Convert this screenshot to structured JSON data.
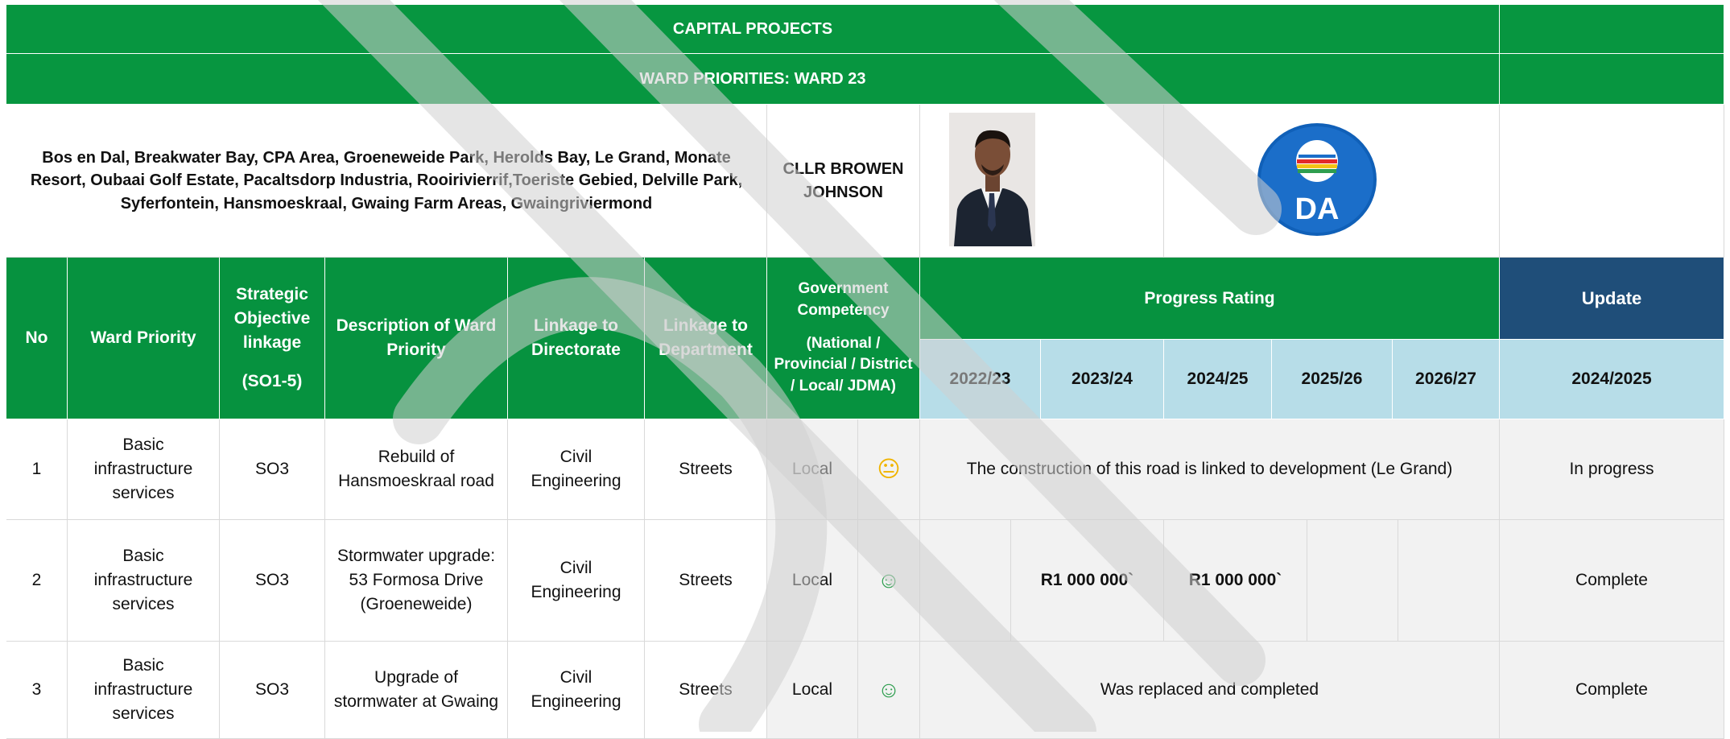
{
  "header": {
    "title": "CAPITAL PROJECTS",
    "subtitle": "WARD PRIORITIES: WARD 23"
  },
  "ward": {
    "areas": "Bos en Dal, Breakwater Bay, CPA Area, Groeneweide Park, Herolds Bay, Le Grand, Monate Resort, Oubaai Golf Estate, Pacaltsdorp Industria, Rooirivierrif,Toeriste Gebied, Delville Park, Syferfontein, Hansmoeskraal, Gwaing Farm Areas, Gwaingriviermond",
    "councillor": "CLLR BROWEN JOHNSON",
    "party_logo_text": "DA"
  },
  "columns": {
    "no": "No",
    "ward_priority": "Ward Priority",
    "strategic_line1": "Strategic Objective linkage",
    "strategic_line2": "(SO1-5)",
    "description": "Description of Ward Priority",
    "directorate": "Linkage to Directorate",
    "department": "Linkage to Department",
    "gov_line1": "Government Competency",
    "gov_line2": "(National / Provincial / District / Local/ JDMA)",
    "progress": "Progress Rating",
    "update": "Update",
    "years": [
      "2022/23",
      "2023/24",
      "2024/25",
      "2025/26",
      "2026/27"
    ],
    "update_year": "2024/2025"
  },
  "rows": [
    {
      "no": "1",
      "priority": "Basic infrastructure services",
      "so": "SO3",
      "description": "Rebuild of Hansmoeskraal road",
      "directorate": "Civil Engineering",
      "department": "Streets",
      "competency": "Local",
      "rating": "neutral",
      "rating_color": "#f0b400",
      "progress_note": "The construction of this road is linked to development (Le Grand)",
      "update": "In progress"
    },
    {
      "no": "2",
      "priority": "Basic infrastructure services",
      "so": "SO3",
      "description": "Stormwater upgrade: 53 Formosa Drive (Groeneweide)",
      "directorate": "Civil Engineering",
      "department": "Streets",
      "competency": "Local",
      "rating": "happy",
      "rating_color": "#2e9e4f",
      "budget_2023_24": "R1 000 000`",
      "budget_2024_25": "R1 000 000`",
      "update": "Complete"
    },
    {
      "no": "3",
      "priority": "Basic infrastructure services",
      "so": "SO3",
      "description": "Upgrade of stormwater at Gwaing",
      "directorate": "Civil Engineering",
      "department": "Streets",
      "competency": "Local",
      "rating": "happy",
      "rating_color": "#2e9e4f",
      "progress_note": "Was replaced and completed",
      "update": "Complete"
    }
  ],
  "icons": {
    "neutral": "😐",
    "happy": "☺"
  },
  "colors": {
    "header_green": "#079640",
    "update_blue": "#1f4e79",
    "year_row_blue": "#b7dde8"
  }
}
